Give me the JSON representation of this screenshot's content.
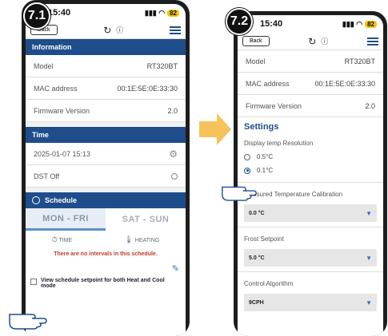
{
  "badges": {
    "left": "7.1",
    "right": "7.2"
  },
  "status": {
    "time": "15:40",
    "battery": "82"
  },
  "appbar": {
    "back": "Back"
  },
  "left": {
    "info_title": "Information",
    "info_rows": [
      {
        "k": "Model",
        "v": "RT320BT"
      },
      {
        "k": "MAC address",
        "v": "00:1E:5E:0E:33:30"
      },
      {
        "k": "Firmware Version",
        "v": "2.0"
      }
    ],
    "time_title": "Time",
    "datetime": "2025-01-07  15:13",
    "dst": "DST  Off",
    "schedule_title": "Schedule",
    "tab1": "MON - FRI",
    "tab2": "SAT - SUN",
    "legend_time": "TIME",
    "legend_heating": "HEATING",
    "empty_msg": "There are no intervals in this schedule.",
    "view_setpoint": "View schedule setpoint for both Heat and Cool mode"
  },
  "right": {
    "info_rows": [
      {
        "k": "Model",
        "v": "RT320BT"
      },
      {
        "k": "MAC address",
        "v": "00:1E:5E:0E:33:30"
      },
      {
        "k": "Firmware Version",
        "v": "2.0"
      }
    ],
    "settings_title": "Settings",
    "resolution_label": "Display temp Resolution",
    "res_opt1": "0.5°C",
    "res_opt2": "0.1°C",
    "calib_label": "Measured Temperature Calibration",
    "calib_value": "0.0 °C",
    "frost_label": "Frost Setpoint",
    "frost_value": "5.0 °C",
    "algo_label": "Control Algorithm",
    "algo_value": "9CPH"
  }
}
